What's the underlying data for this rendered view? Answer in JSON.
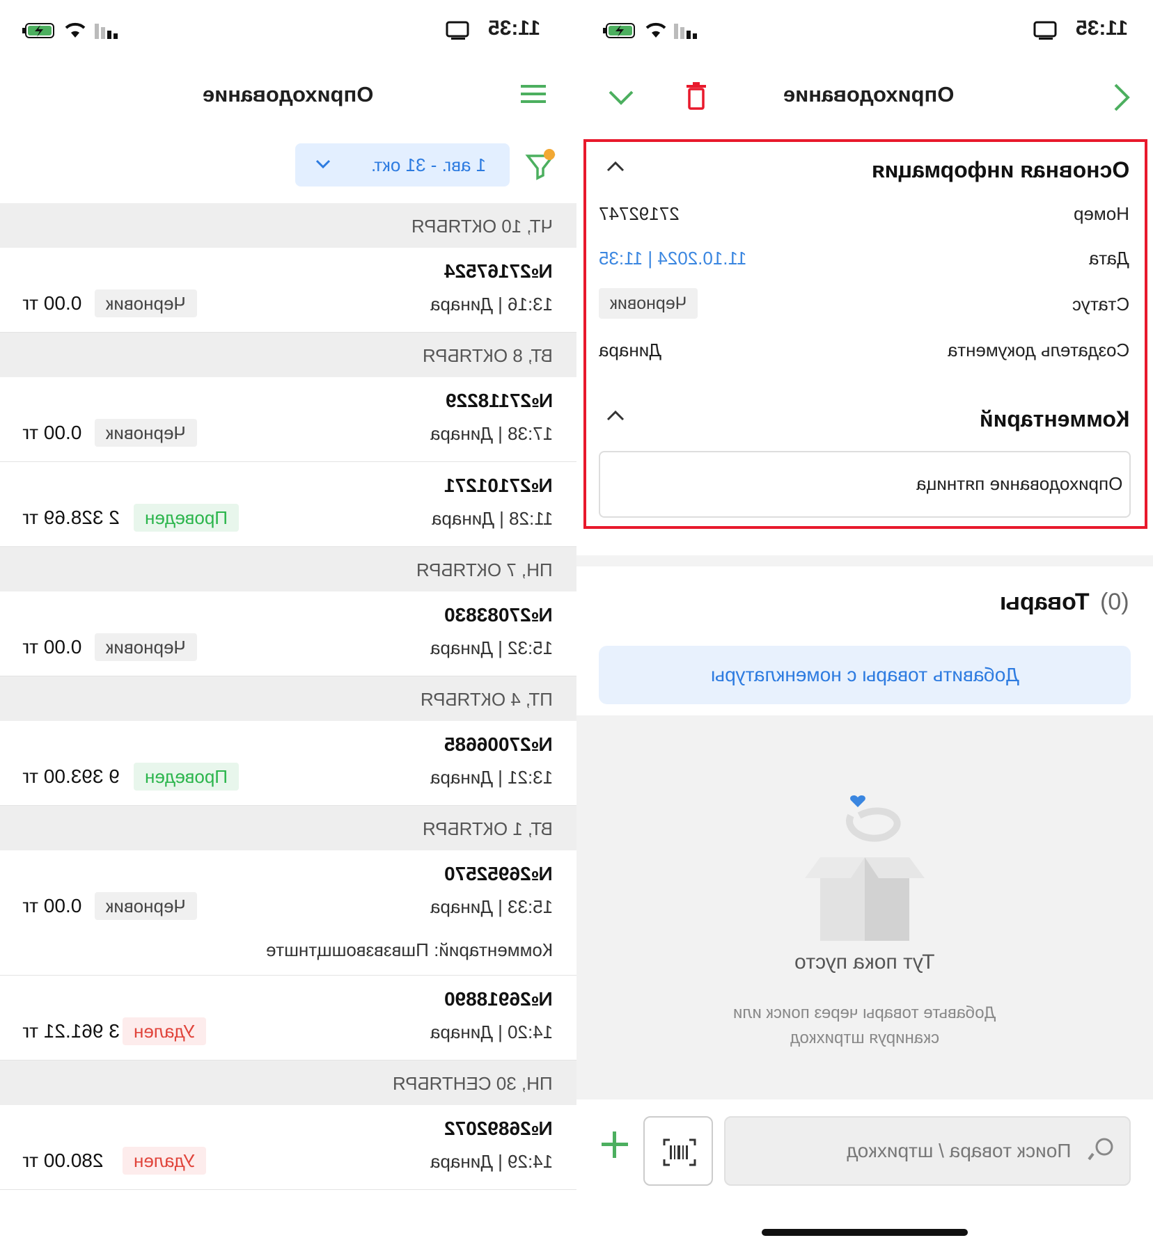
{
  "status_bar": {
    "time": "11:35"
  },
  "list_screen": {
    "title": "Оприходование",
    "period_filter": "1 авг. - 31 окт.",
    "days": [
      {
        "label": "ЧТ, 10 ОКТЯБРЯ",
        "docs": [
          {
            "number": "№27167524",
            "meta": "13:16 | Динара",
            "status": "Черновик",
            "sum": "0.00 тг"
          }
        ]
      },
      {
        "label": "ВТ, 8 ОКТЯБРЯ",
        "docs": [
          {
            "number": "№27118229",
            "meta": "17:38 | Динара",
            "status": "Черновик",
            "sum": "0.00 тг"
          },
          {
            "number": "№27101271",
            "meta": "11:28 | Динара",
            "status": "Проведен",
            "sum": "2 328.69 тг"
          }
        ]
      },
      {
        "label": "ПН, 7 ОКТЯБРЯ",
        "docs": [
          {
            "number": "№27083830",
            "meta": "15:32 | Динара",
            "status": "Черновик",
            "sum": "0.00 тг"
          }
        ]
      },
      {
        "label": "ПТ, 4 ОКТЯБРЯ",
        "docs": [
          {
            "number": "№27006685",
            "meta": "13:21 | Динара",
            "status": "Проведен",
            "sum": "9 393.00 тг"
          }
        ]
      },
      {
        "label": "ВТ, 1 ОКТЯБРЯ",
        "docs": [
          {
            "number": "№26952570",
            "meta": "15:33 | Динара",
            "status": "Черновик",
            "sum": "0.00 тг",
            "comment": "Комментарий: Пшвзвзвошщтнште"
          },
          {
            "number": "№26918890",
            "meta": "14:20 | Динара",
            "status": "Удален",
            "sum": "3 961.21 тг"
          }
        ]
      },
      {
        "label": "ПН, 30 СЕНТЯБРЯ",
        "docs": [
          {
            "number": "№26892072",
            "meta": "14:29 | Динара",
            "status": "Удален",
            "sum": "280.00 тг"
          }
        ]
      }
    ],
    "fab_label": "+"
  },
  "detail_screen": {
    "title": "Оприходование",
    "main_info": {
      "title": "Основная информация",
      "number_label": "Номер",
      "number_value": "27192747",
      "date_label": "Дата",
      "date_value": "11.10.2024 | 11:35",
      "status_label": "Статус",
      "status_value": "Черновик",
      "creator_label": "Создатель документа",
      "creator_value": "Динара"
    },
    "comment": {
      "title": "Комментарий",
      "value": "Оприходование пятница"
    },
    "goods": {
      "title": "Товары",
      "count": "(0)",
      "add_button": "Добавить товары с номенклатуры",
      "empty_title": "Тут пока пусто",
      "empty_text_1": "Добавьте товары через поиск или",
      "empty_text_2": "сканируя штрихкод"
    },
    "search": {
      "placeholder": "Поиск товара / штрихкод"
    }
  },
  "colors": {
    "green": "#4caf5f",
    "red_accent": "#e8192c",
    "blue_link": "#3a86e0"
  }
}
